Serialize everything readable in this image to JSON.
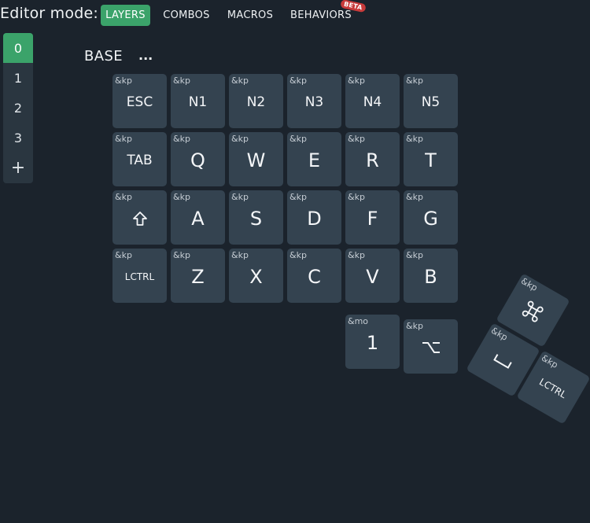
{
  "header": {
    "editor_label": "Editor mode:",
    "tabs": [
      "LAYERS",
      "COMBOS",
      "MACROS",
      "BEHAVIORS"
    ],
    "beta_badge": "BETA"
  },
  "layers": {
    "items": [
      "0",
      "1",
      "2",
      "3"
    ],
    "add_symbol": "+",
    "active": "0"
  },
  "layer_title": "BASE",
  "layer_menu": "...",
  "keys": [
    {
      "binding": "&kp",
      "legend": "ESC"
    },
    {
      "binding": "&kp",
      "legend": "N1"
    },
    {
      "binding": "&kp",
      "legend": "N2"
    },
    {
      "binding": "&kp",
      "legend": "N3"
    },
    {
      "binding": "&kp",
      "legend": "N4"
    },
    {
      "binding": "&kp",
      "legend": "N5"
    },
    {
      "binding": "&kp",
      "legend": "TAB"
    },
    {
      "binding": "&kp",
      "legend": "Q"
    },
    {
      "binding": "&kp",
      "legend": "W"
    },
    {
      "binding": "&kp",
      "legend": "E"
    },
    {
      "binding": "&kp",
      "legend": "R"
    },
    {
      "binding": "&kp",
      "legend": "T"
    },
    {
      "binding": "&kp",
      "legend": "shift-icon"
    },
    {
      "binding": "&kp",
      "legend": "A"
    },
    {
      "binding": "&kp",
      "legend": "S"
    },
    {
      "binding": "&kp",
      "legend": "D"
    },
    {
      "binding": "&kp",
      "legend": "F"
    },
    {
      "binding": "&kp",
      "legend": "G"
    },
    {
      "binding": "&kp",
      "legend": "LCTRL"
    },
    {
      "binding": "&kp",
      "legend": "Z"
    },
    {
      "binding": "&kp",
      "legend": "X"
    },
    {
      "binding": "&kp",
      "legend": "C"
    },
    {
      "binding": "&kp",
      "legend": "V"
    },
    {
      "binding": "&kp",
      "legend": "B"
    },
    {
      "binding": "&mo",
      "legend": "1"
    },
    {
      "binding": "&kp",
      "legend": "option-icon"
    },
    {
      "binding": "&kp",
      "legend": "command-icon"
    },
    {
      "binding": "&kp",
      "legend": "space-icon"
    },
    {
      "binding": "&kp",
      "legend": "LCTRL"
    }
  ],
  "colors": {
    "background": "#1b232c",
    "key": "#344350",
    "accent": "#3ba36a",
    "badge": "#c83a3a"
  }
}
